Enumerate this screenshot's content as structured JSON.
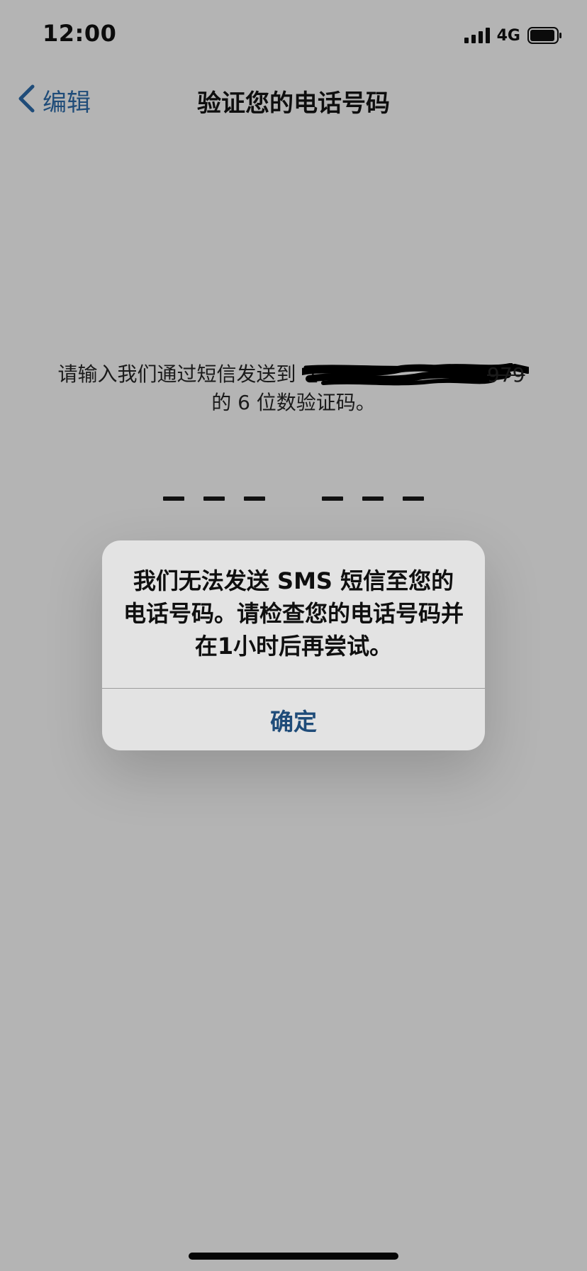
{
  "status_bar": {
    "time": "12:00",
    "network": "4G",
    "signal_icon": "signal-bars-icon",
    "battery_icon": "battery-icon"
  },
  "nav": {
    "back_icon": "chevron-left-icon",
    "back_label": "编辑",
    "title": "验证您的电话号码"
  },
  "instruction": {
    "prefix": "请输入我们通过短信发送到",
    "phone_visible_suffix": "979",
    "suffix": "的 6 位数验证码。"
  },
  "code_input": {
    "slot_count": 6
  },
  "alert": {
    "message": "我们无法发送 SMS 短信至您的电话号码。请检查您的电话号码并在1小时后再尝试。",
    "ok_label": "确定"
  },
  "colors": {
    "background": "#b4b4b4",
    "accent": "#1f4c79",
    "alert_background": "#e3e3e3"
  }
}
